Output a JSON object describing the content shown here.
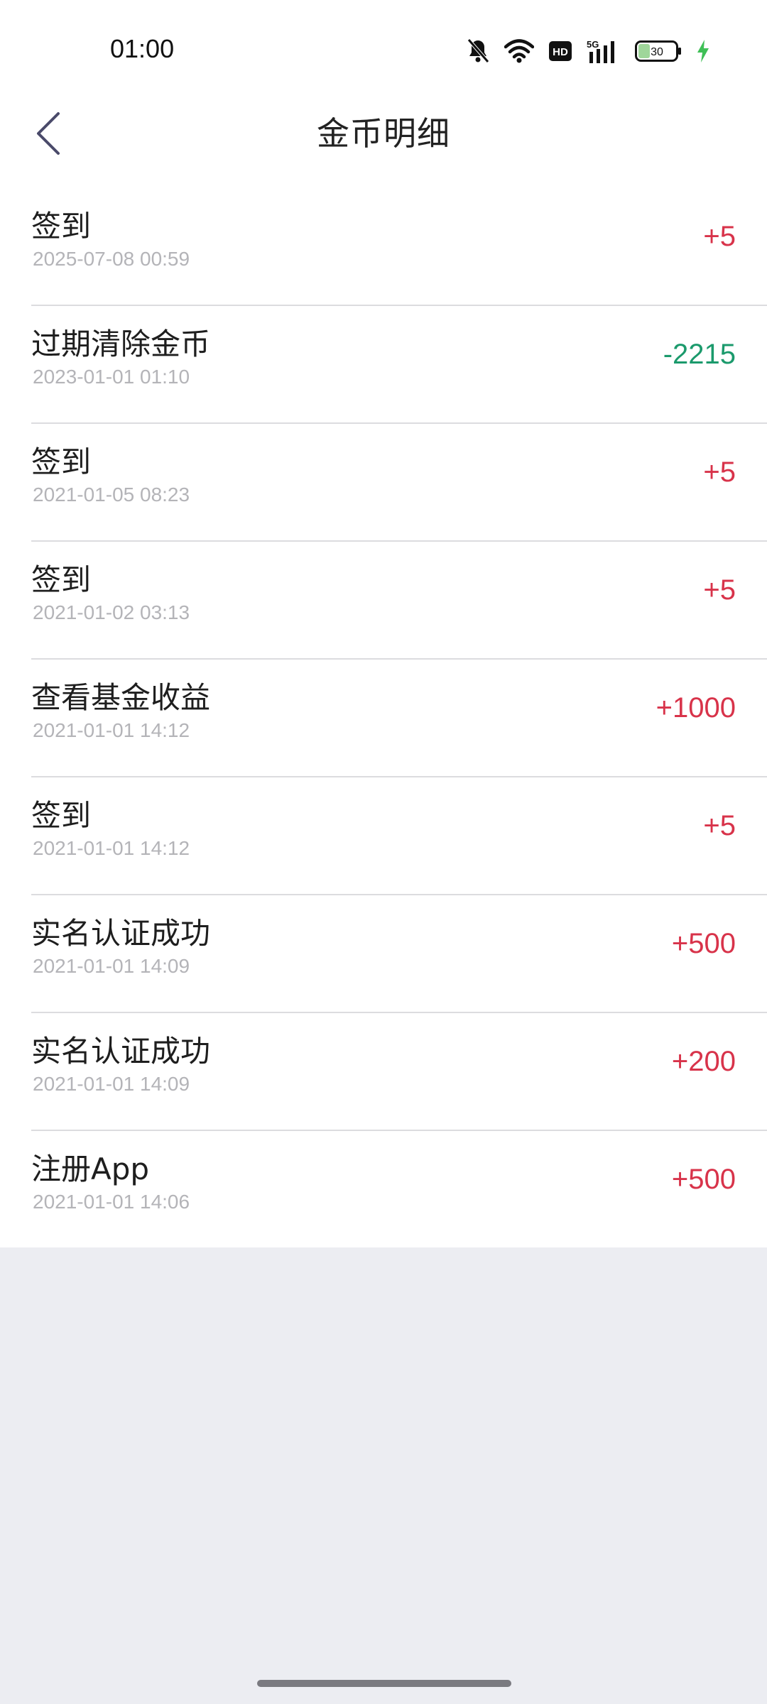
{
  "status_bar": {
    "time": "01:00",
    "network_badge": "HD",
    "signal_label": "5G",
    "battery_level": "30"
  },
  "header": {
    "title": "金币明细"
  },
  "colors": {
    "positive": "#d8334a",
    "negative": "#1b9a6c"
  },
  "records": [
    {
      "title": "签到",
      "date": "2025-07-08 00:59",
      "amount": "+5",
      "type": "positive"
    },
    {
      "title": "过期清除金币",
      "date": "2023-01-01 01:10",
      "amount": "-2215",
      "type": "negative"
    },
    {
      "title": "签到",
      "date": "2021-01-05 08:23",
      "amount": "+5",
      "type": "positive"
    },
    {
      "title": "签到",
      "date": "2021-01-02 03:13",
      "amount": "+5",
      "type": "positive"
    },
    {
      "title": "查看基金收益",
      "date": "2021-01-01 14:12",
      "amount": "+1000",
      "type": "positive"
    },
    {
      "title": "签到",
      "date": "2021-01-01 14:12",
      "amount": "+5",
      "type": "positive"
    },
    {
      "title": "实名认证成功",
      "date": "2021-01-01 14:09",
      "amount": "+500",
      "type": "positive"
    },
    {
      "title": "实名认证成功",
      "date": "2021-01-01 14:09",
      "amount": "+200",
      "type": "positive"
    },
    {
      "title": "注册App",
      "date": "2021-01-01 14:06",
      "amount": "+500",
      "type": "positive"
    }
  ]
}
